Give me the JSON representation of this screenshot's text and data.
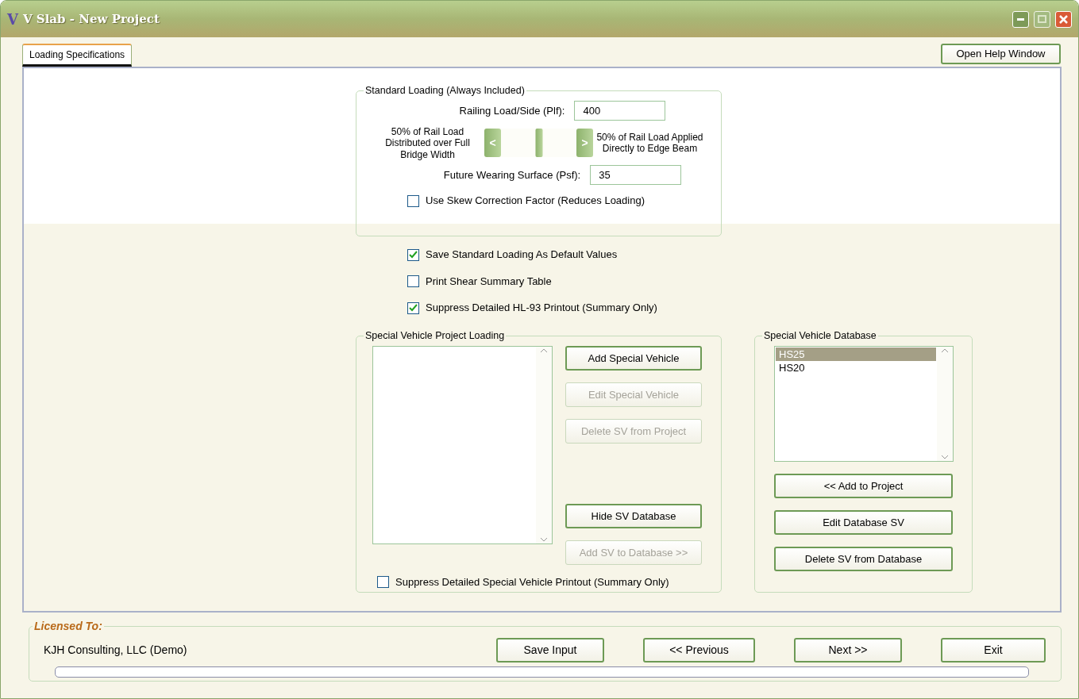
{
  "window": {
    "logo": "V",
    "title": "V Slab - New Project",
    "maximize_disabled": true
  },
  "tabs": [
    {
      "label": "Loading Specifications",
      "selected": true
    }
  ],
  "help_button": {
    "label": "Open Help Window"
  },
  "standard_loading": {
    "title": "Standard Loading  (Always Included)",
    "railing": {
      "label": "Railing Load/Side (Plf):",
      "value": "400"
    },
    "distribution": {
      "left_label": "50% of Rail Load Distributed over Full Bridge Width",
      "right_label": "50% of Rail Load Applied Directly to Edge Beam",
      "left_arrow": "<",
      "right_arrow": ">",
      "level": 0.5
    },
    "wearing": {
      "label": "Future Wearing Surface (Psf):",
      "value": "35"
    },
    "skew": {
      "label": "Use Skew Correction Factor (Reduces Loading)",
      "checked": false
    }
  },
  "options": [
    {
      "label": "Save Standard Loading As Default Values",
      "checked": true
    },
    {
      "label": "Print Shear Summary Table",
      "checked": false
    },
    {
      "label": "Suppress Detailed HL-93 Printout (Summary Only)",
      "checked": true
    }
  ],
  "sv_project": {
    "title": "Special Vehicle Project Loading",
    "buttons": [
      {
        "label": "Add Special Vehicle",
        "disabled": false
      },
      {
        "label": "Edit Special Vehicle",
        "disabled": true
      },
      {
        "label": "Delete SV from Project",
        "disabled": true
      },
      {
        "label": "Hide SV Database",
        "disabled": false
      },
      {
        "label": "Add SV to Database >>",
        "disabled": true
      }
    ],
    "suppress": {
      "label": "Suppress Detailed Special Vehicle Printout (Summary Only)",
      "checked": false
    }
  },
  "sv_database": {
    "title": "Special Vehicle Database",
    "items": [
      {
        "label": "HS25",
        "selected": true
      },
      {
        "label": "HS20",
        "selected": false
      }
    ],
    "buttons": [
      {
        "label": "<< Add to Project",
        "disabled": false
      },
      {
        "label": "Edit Database SV",
        "disabled": false
      },
      {
        "label": "Delete SV from Database",
        "disabled": false
      }
    ]
  },
  "license": {
    "title": "Licensed To:",
    "holder": "KJH Consulting, LLC (Demo)",
    "buttons": [
      {
        "label": "Save Input"
      },
      {
        "label": "<< Previous"
      },
      {
        "label": "Next >>"
      },
      {
        "label": "Exit"
      }
    ]
  }
}
